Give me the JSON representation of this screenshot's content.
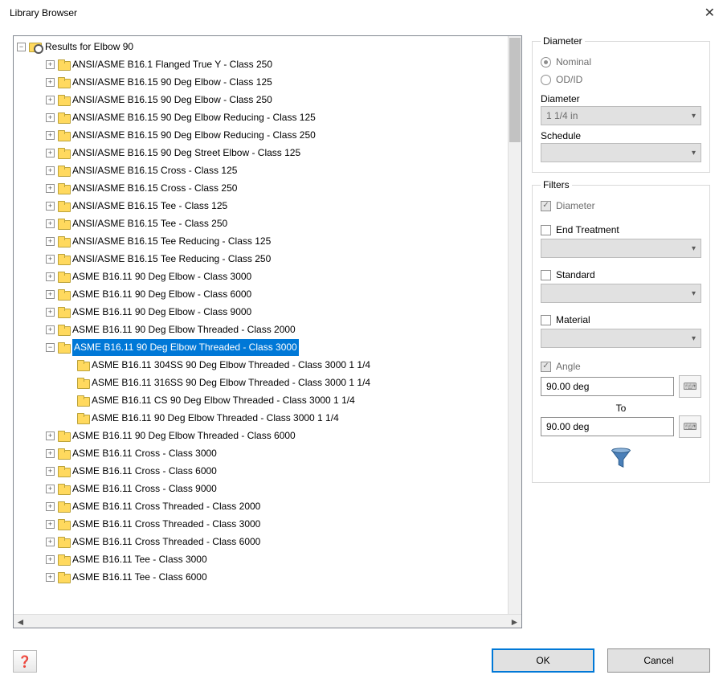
{
  "window": {
    "title": "Library Browser",
    "close_icon": "✕"
  },
  "tree": {
    "root_label": "Results for Elbow 90",
    "items": [
      {
        "label": "ANSI/ASME B16.1 Flanged True Y - Class 250",
        "exp": "+"
      },
      {
        "label": "ANSI/ASME B16.15 90 Deg Elbow - Class 125",
        "exp": "+"
      },
      {
        "label": "ANSI/ASME B16.15 90 Deg Elbow - Class 250",
        "exp": "+"
      },
      {
        "label": "ANSI/ASME B16.15 90 Deg Elbow Reducing - Class 125",
        "exp": "+"
      },
      {
        "label": "ANSI/ASME B16.15 90 Deg Elbow Reducing - Class 250",
        "exp": "+"
      },
      {
        "label": "ANSI/ASME B16.15 90 Deg Street Elbow - Class 125",
        "exp": "+"
      },
      {
        "label": "ANSI/ASME B16.15 Cross - Class 125",
        "exp": "+"
      },
      {
        "label": "ANSI/ASME B16.15 Cross - Class 250",
        "exp": "+"
      },
      {
        "label": "ANSI/ASME B16.15 Tee - Class 125",
        "exp": "+"
      },
      {
        "label": "ANSI/ASME B16.15 Tee - Class 250",
        "exp": "+"
      },
      {
        "label": "ANSI/ASME B16.15 Tee Reducing - Class 125",
        "exp": "+"
      },
      {
        "label": "ANSI/ASME B16.15 Tee Reducing - Class 250",
        "exp": "+"
      },
      {
        "label": "ASME B16.11 90 Deg Elbow - Class 3000",
        "exp": "+"
      },
      {
        "label": "ASME B16.11 90 Deg Elbow - Class 6000",
        "exp": "+"
      },
      {
        "label": "ASME B16.11 90 Deg Elbow - Class 9000",
        "exp": "+"
      },
      {
        "label": "ASME B16.11 90 Deg Elbow Threaded - Class 2000",
        "exp": "+"
      },
      {
        "label": "ASME B16.11 90 Deg Elbow Threaded - Class 3000",
        "exp": "−",
        "selected": true,
        "children": [
          "ASME B16.11 304SS 90 Deg Elbow Threaded - Class 3000 1 1/4",
          "ASME B16.11 316SS 90 Deg Elbow Threaded - Class 3000 1 1/4",
          "ASME B16.11 CS 90 Deg Elbow Threaded - Class 3000 1 1/4",
          "ASME B16.11 90 Deg Elbow Threaded - Class 3000 1 1/4"
        ]
      },
      {
        "label": "ASME B16.11 90 Deg Elbow Threaded - Class 6000",
        "exp": "+"
      },
      {
        "label": "ASME B16.11 Cross - Class 3000",
        "exp": "+"
      },
      {
        "label": "ASME B16.11 Cross - Class 6000",
        "exp": "+"
      },
      {
        "label": "ASME B16.11 Cross - Class 9000",
        "exp": "+"
      },
      {
        "label": "ASME B16.11 Cross Threaded - Class 2000",
        "exp": "+"
      },
      {
        "label": "ASME B16.11 Cross Threaded - Class 3000",
        "exp": "+"
      },
      {
        "label": "ASME B16.11 Cross Threaded - Class 6000",
        "exp": "+"
      },
      {
        "label": "ASME B16.11 Tee - Class 3000",
        "exp": "+"
      },
      {
        "label": "ASME B16.11 Tee - Class 6000",
        "exp": "+"
      }
    ]
  },
  "diameter": {
    "legend": "Diameter",
    "radio_nominal": "Nominal",
    "radio_odid": "OD/ID",
    "diameter_label": "Diameter",
    "diameter_value": "1 1/4 in",
    "schedule_label": "Schedule",
    "schedule_value": ""
  },
  "filters": {
    "legend": "Filters",
    "diameter_label": "Diameter",
    "end_treatment_label": "End Treatment",
    "standard_label": "Standard",
    "material_label": "Material",
    "angle_label": "Angle",
    "angle_from": "90.00 deg",
    "to_label": "To",
    "angle_to": "90.00 deg"
  },
  "buttons": {
    "ok": "OK",
    "cancel": "Cancel"
  }
}
